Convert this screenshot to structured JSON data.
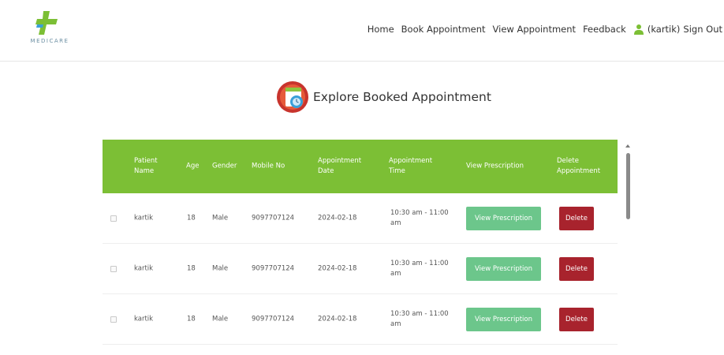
{
  "brand": {
    "name": "MEDICARE",
    "colors": {
      "green": "#7cbf35",
      "cross_blue": "#3aa0d8",
      "wordmark": "#6b8fa3"
    }
  },
  "nav": {
    "items": [
      {
        "label": "Home"
      },
      {
        "label": "Book Appointment"
      },
      {
        "label": "View Appointment"
      },
      {
        "label": "Feedback"
      }
    ],
    "user_label": "(kartik)",
    "signout_label": "Sign Out",
    "user_icon": "user-icon"
  },
  "page": {
    "title": "Explore Booked Appointment",
    "title_icon": "calendar-icon"
  },
  "table": {
    "header_color": "#7cbf35",
    "columns": [
      "Patient Name",
      "Age",
      "Gender",
      "Mobile No",
      "Appointment Date",
      "Appointment Time",
      "View Prescription",
      "Delete Appointment"
    ],
    "rows": [
      {
        "name": "kartik",
        "age": "18",
        "gender": "Male",
        "mobile": "9097707124",
        "date": "2024-02-18",
        "time": "10:30 am - 11:00 am",
        "view_label": "View Prescription",
        "delete_label": "Delete"
      },
      {
        "name": "kartik",
        "age": "18",
        "gender": "Male",
        "mobile": "9097707124",
        "date": "2024-02-18",
        "time": "10:30 am - 11:00 am",
        "view_label": "View Prescription",
        "delete_label": "Delete"
      },
      {
        "name": "kartik",
        "age": "18",
        "gender": "Male",
        "mobile": "9097707124",
        "date": "2024-02-18",
        "time": "10:30 am - 11:00 am",
        "view_label": "View Prescription",
        "delete_label": "Delete"
      }
    ],
    "button_colors": {
      "view": "#6cc68b",
      "delete": "#a8232d"
    }
  }
}
